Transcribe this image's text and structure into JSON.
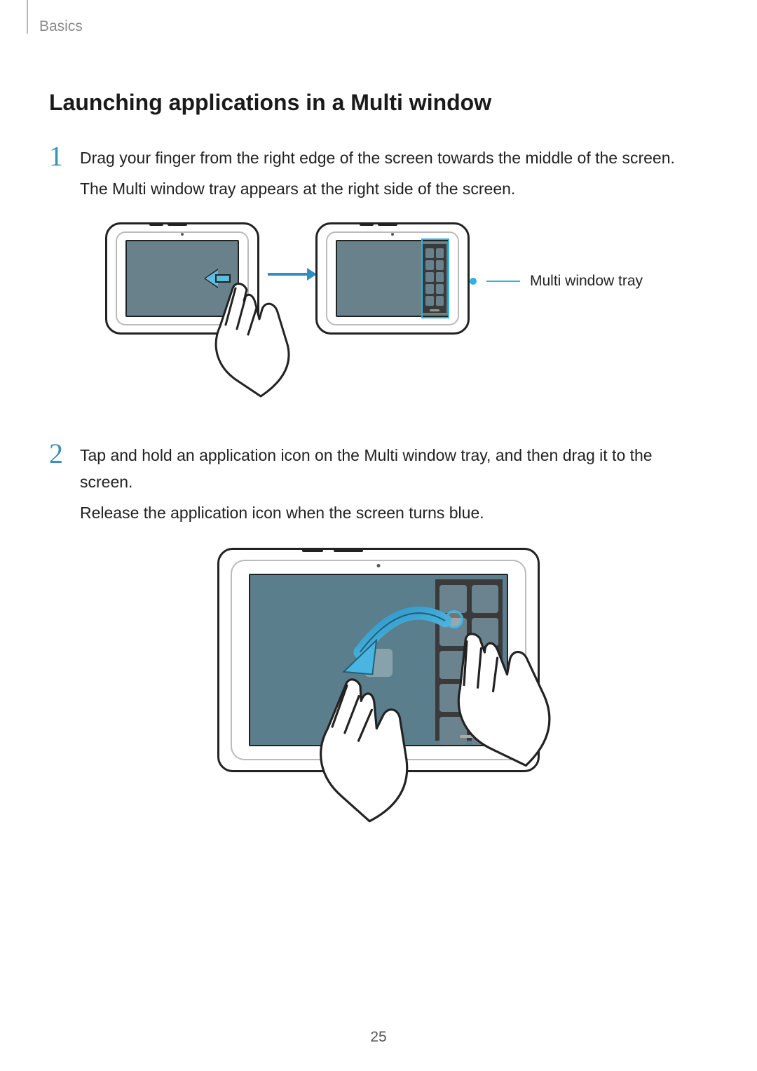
{
  "header": {
    "section": "Basics"
  },
  "title": "Launching applications in a Multi window",
  "steps": [
    {
      "num": "1",
      "lines": [
        "Drag your finger from the right edge of the screen towards the middle of the screen.",
        "The Multi window tray appears at the right side of the screen."
      ]
    },
    {
      "num": "2",
      "lines": [
        "Tap and hold an application icon on the Multi window tray, and then drag it to the screen.",
        "Release the application icon when the screen turns blue."
      ]
    }
  ],
  "callouts": {
    "tray": "Multi window tray"
  },
  "page_number": "25"
}
